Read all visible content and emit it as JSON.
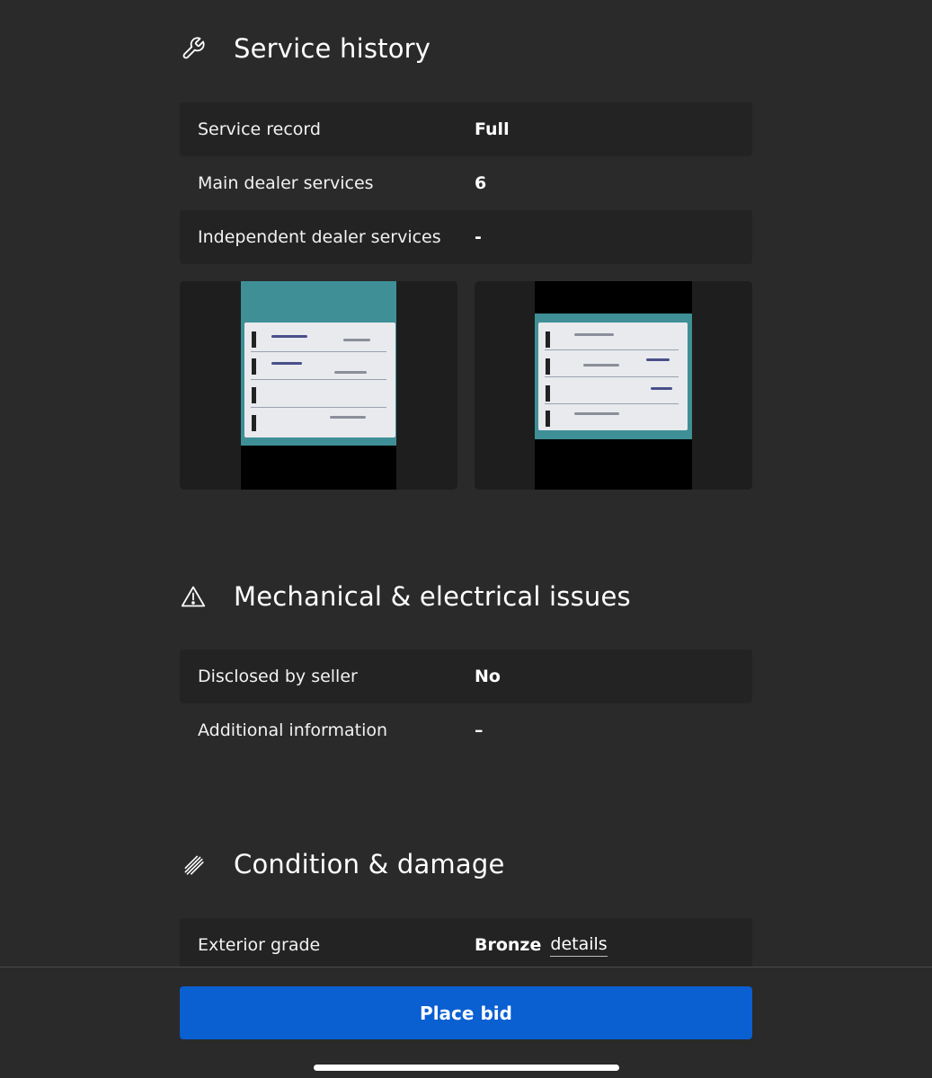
{
  "service_history": {
    "title": "Service history",
    "icon": "wrench-icon",
    "rows": [
      {
        "label": "Service record",
        "value": "Full"
      },
      {
        "label": "Main dealer services",
        "value": "6"
      },
      {
        "label": "Independent dealer services",
        "value": "-"
      }
    ]
  },
  "mechanical": {
    "title": "Mechanical & electrical issues",
    "icon": "warning-icon",
    "rows": [
      {
        "label": "Disclosed by seller",
        "value": "No"
      },
      {
        "label": "Additional information",
        "value": "–"
      }
    ]
  },
  "condition": {
    "title": "Condition & damage",
    "icon": "scratch-icon",
    "rows": [
      {
        "label": "Exterior grade",
        "value": "Bronze",
        "link": "details"
      }
    ]
  },
  "actions": {
    "place_bid": "Place bid"
  },
  "colors": {
    "background": "#2a2a2a",
    "row_shade": "#232323",
    "primary_button": "#0a5fd1"
  }
}
